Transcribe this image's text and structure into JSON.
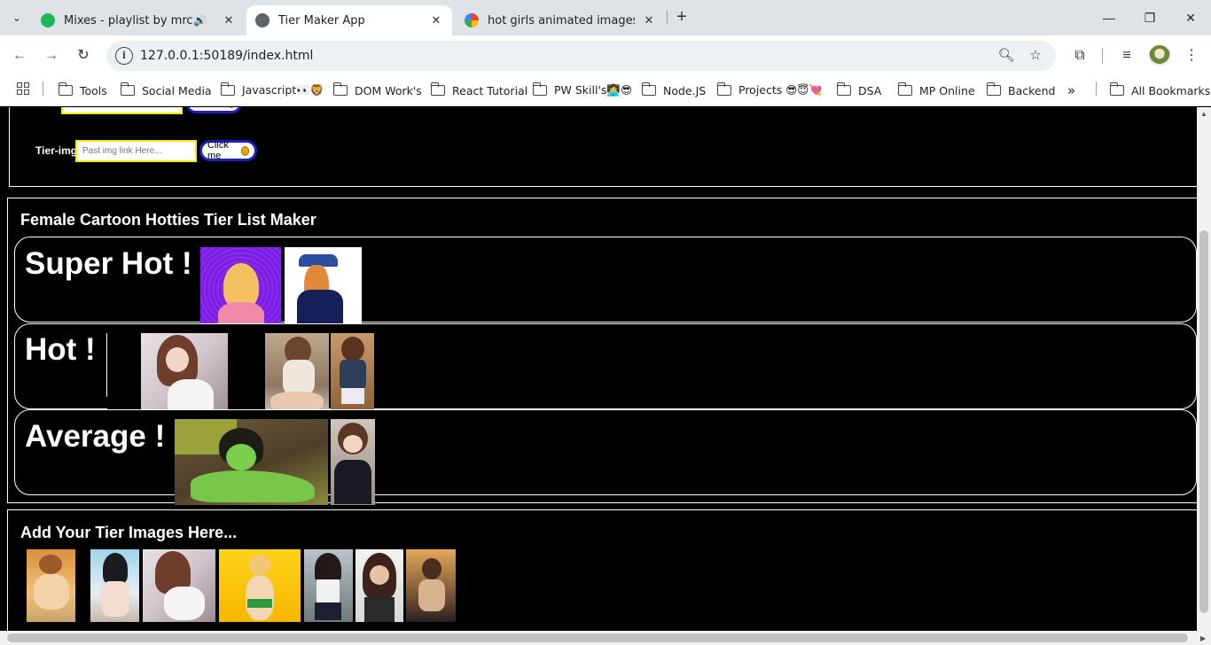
{
  "browser": {
    "tabs": [
      {
        "title": "Mixes - playlist by mrcs | Spotify",
        "active": false
      },
      {
        "title": "Tier Maker App",
        "active": true
      },
      {
        "title": "hot girls animated images - Google Search",
        "active": false
      }
    ],
    "url": "127.0.0.1:50189/index.html",
    "bookmarks": [
      "Tools",
      "Social Media",
      "Javascript👀🦁",
      "DOM Work's",
      "React Tutorial",
      "PW Skill's👩‍💻😎",
      "Node.JS",
      "Projects 😎😇💘",
      "DSA",
      "MP Online",
      "Backend"
    ],
    "all_bookmarks": "All Bookmarks",
    "more_bookmarks": "»"
  },
  "controls": {
    "tier_img_label": "Tier-img",
    "tier_img_placeholder": "Past img link Here...",
    "button_label": "Click me"
  },
  "tier_list": {
    "title": "Female Cartoon Hotties Tier List Maker",
    "tiers": [
      {
        "label": "Super Hot !"
      },
      {
        "label": "Hot !"
      },
      {
        "label": "Average !"
      }
    ]
  },
  "pool": {
    "title": "Add Your Tier Images Here..."
  },
  "colors": {
    "page_bg": "#000000",
    "input_border": "#ffea00",
    "button_border": "#1c1ec8",
    "text": "#ffffff"
  }
}
